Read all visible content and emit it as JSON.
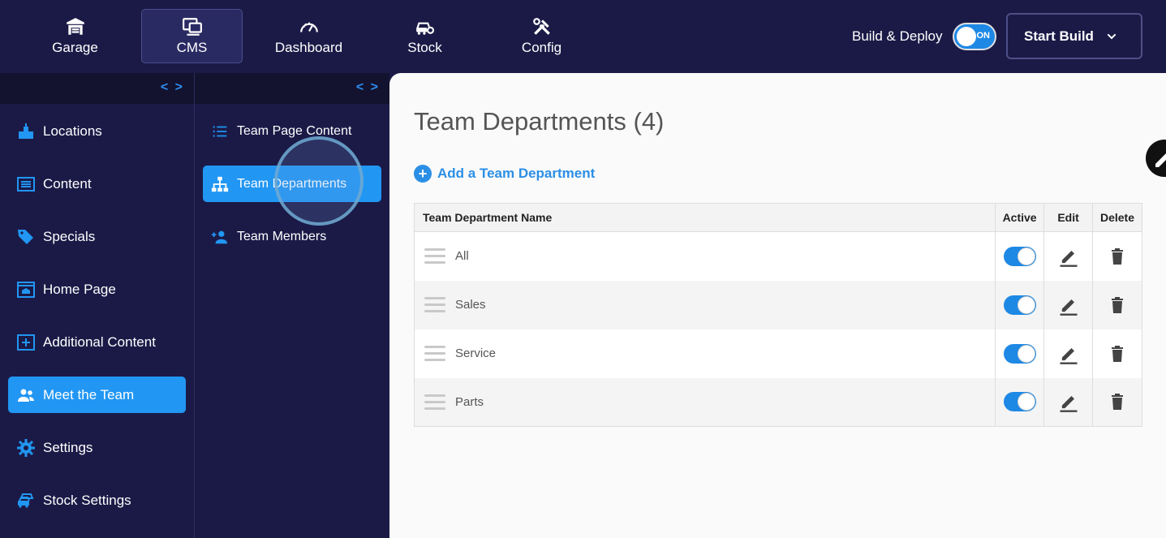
{
  "nav": {
    "items": [
      {
        "label": "Garage",
        "icon": "garage-icon"
      },
      {
        "label": "CMS",
        "icon": "cms-icon",
        "active": true
      },
      {
        "label": "Dashboard",
        "icon": "speedometer-icon"
      },
      {
        "label": "Stock",
        "icon": "car-cog-icon"
      },
      {
        "label": "Config",
        "icon": "tools-icon"
      }
    ],
    "build_deploy_label": "Build & Deploy",
    "toggle_text": "ON",
    "start_build_label": "Start Build"
  },
  "sidebar": {
    "items": [
      {
        "label": "Locations"
      },
      {
        "label": "Content"
      },
      {
        "label": "Specials"
      },
      {
        "label": "Home Page"
      },
      {
        "label": "Additional Content"
      },
      {
        "label": "Meet the Team",
        "active": true
      },
      {
        "label": "Settings"
      },
      {
        "label": "Stock Settings"
      }
    ]
  },
  "subnav": {
    "items": [
      {
        "label": "Team Page Content"
      },
      {
        "label": "Team Departments",
        "active": true
      },
      {
        "label": "Team Members"
      }
    ]
  },
  "main": {
    "title": "Team Departments (4)",
    "add_label": "Add a Team Department",
    "table": {
      "headers": [
        "Team Department Name",
        "Active",
        "Edit",
        "Delete"
      ],
      "rows": [
        {
          "name": "All",
          "active": true
        },
        {
          "name": "Sales",
          "active": true
        },
        {
          "name": "Service",
          "active": true
        },
        {
          "name": "Parts",
          "active": true
        }
      ]
    }
  },
  "colors": {
    "accent": "#2196f3",
    "nav_bg": "#1b1a47",
    "link": "#2b8fe6"
  }
}
